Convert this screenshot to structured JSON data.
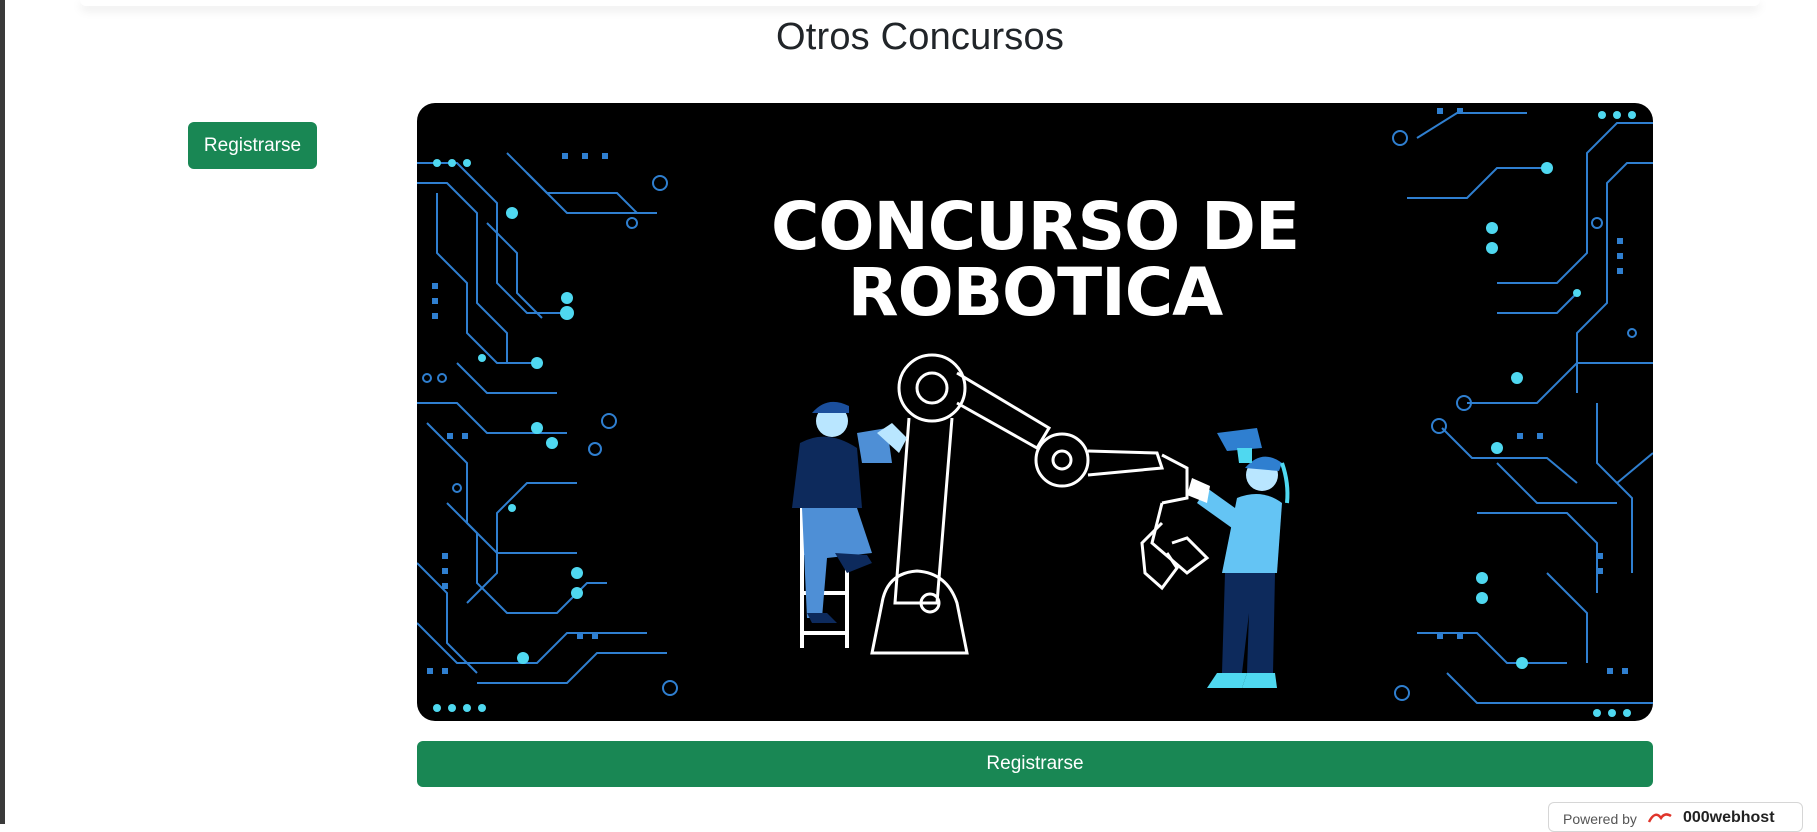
{
  "page": {
    "title": "Otros Concursos"
  },
  "side_button": {
    "label": "Registrarse"
  },
  "banner": {
    "title_line1": "CONCURSO DE",
    "title_line2": "ROBOTICA",
    "background_color": "#000000",
    "accent_color": "#4fd8f0"
  },
  "wide_button": {
    "label": "Registrarse"
  },
  "footer": {
    "powered_by": "Powered by",
    "brand": "000webhost"
  },
  "colors": {
    "button": "#198754",
    "text": "#212529"
  }
}
